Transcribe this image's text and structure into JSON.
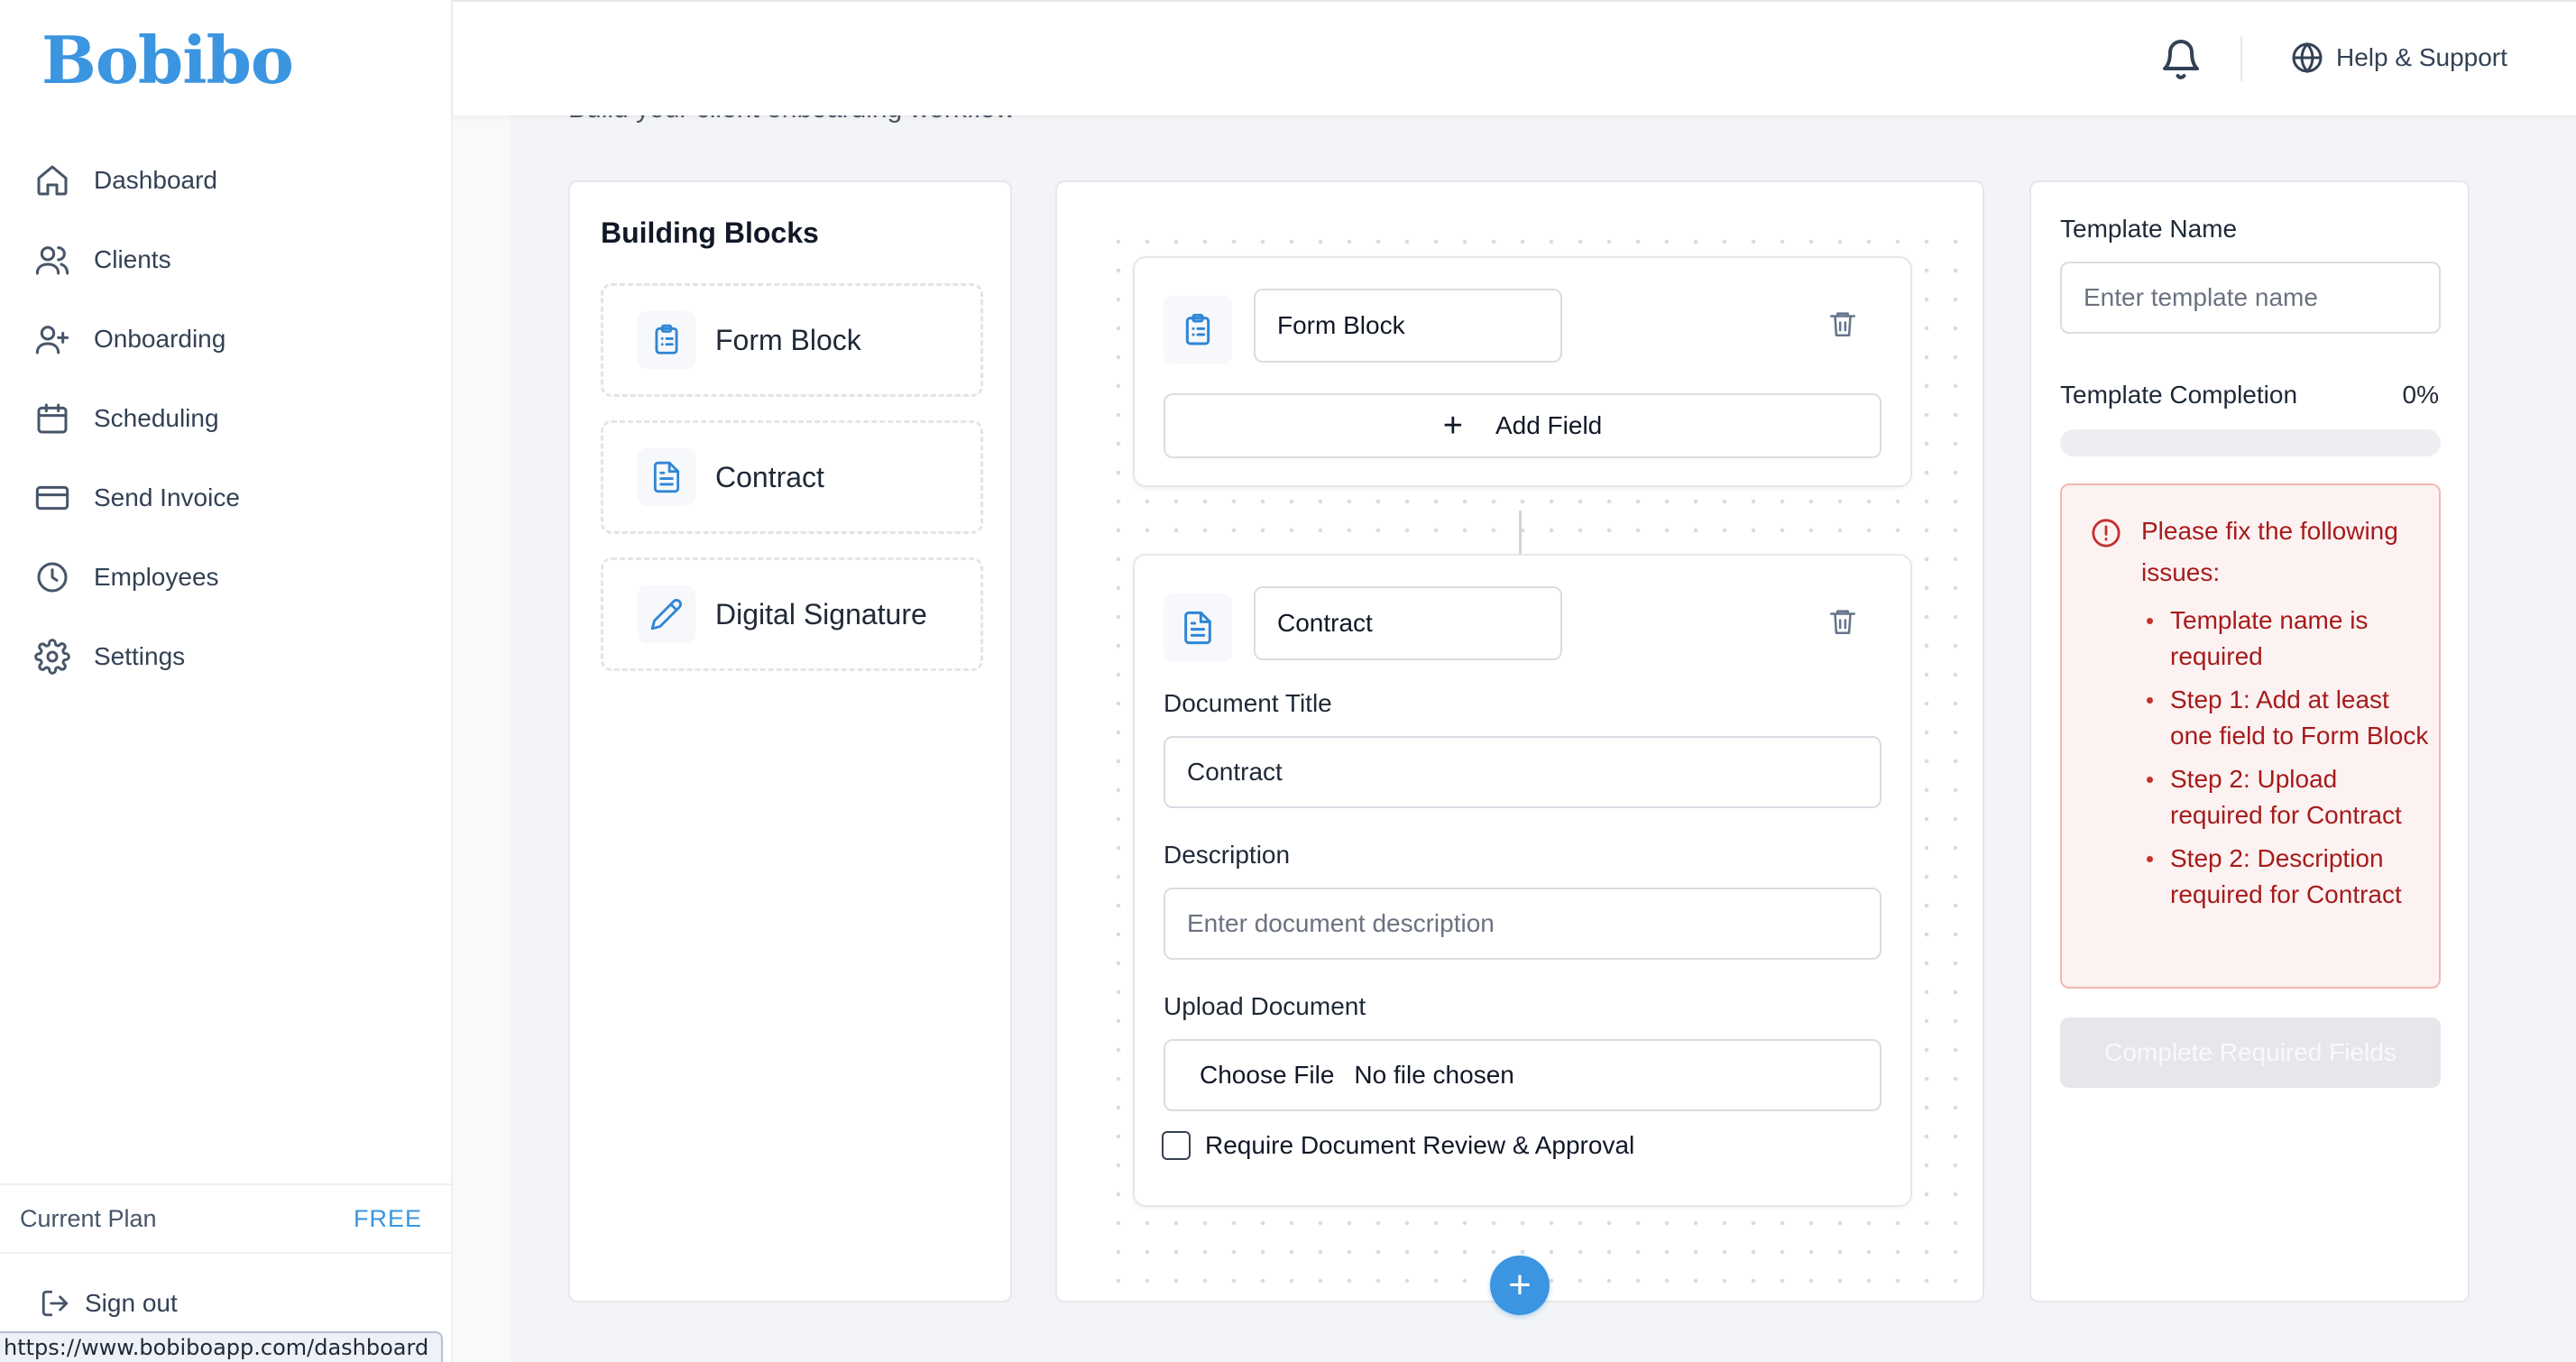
{
  "app": {
    "logo": "Bobibo"
  },
  "sidebar": {
    "items": [
      {
        "label": "Dashboard",
        "icon": "home-icon"
      },
      {
        "label": "Clients",
        "icon": "users-icon"
      },
      {
        "label": "Onboarding",
        "icon": "user-plus-icon"
      },
      {
        "label": "Scheduling",
        "icon": "calendar-icon"
      },
      {
        "label": "Send Invoice",
        "icon": "credit-card-icon"
      },
      {
        "label": "Employees",
        "icon": "clock-icon"
      },
      {
        "label": "Settings",
        "icon": "gear-icon"
      }
    ],
    "plan_label": "Current Plan",
    "plan_value": "FREE",
    "signout_label": "Sign out"
  },
  "status_bar": {
    "url": "https://www.bobiboapp.com/dashboard"
  },
  "header": {
    "help_label": "Help & Support"
  },
  "page": {
    "subtitle": "Build your client onboarding workflow"
  },
  "building_blocks": {
    "title": "Building Blocks",
    "items": [
      {
        "label": "Form Block",
        "icon": "clipboard-list-icon"
      },
      {
        "label": "Contract",
        "icon": "document-icon"
      },
      {
        "label": "Digital Signature",
        "icon": "pen-icon"
      }
    ]
  },
  "canvas": {
    "steps": [
      {
        "name_value": "Form Block",
        "add_field_label": "Add Field"
      },
      {
        "name_value": "Contract",
        "document_title_label": "Document Title",
        "document_title_value": "Contract",
        "description_label": "Description",
        "description_placeholder": "Enter document description",
        "upload_label": "Upload Document",
        "choose_file_label": "Choose File",
        "no_file_label": "No file chosen",
        "review_label": "Require Document Review & Approval",
        "review_checked": false
      }
    ],
    "add_step_label": "+"
  },
  "template": {
    "name_label": "Template Name",
    "name_placeholder": "Enter template name",
    "completion_label": "Template Completion",
    "completion_value": "0%",
    "completion_fraction": 0,
    "errors_title": "Please fix the following issues:",
    "errors": [
      "Template name is required",
      "Step 1: Add at least one field to Form Block",
      "Step 2: Upload required for Contract",
      "Step 2: Description required for Contract"
    ],
    "submit_label": "Complete Required Fields"
  },
  "colors": {
    "brand": "#3b95e0",
    "error": "#a61b1b",
    "error_bg": "#fdf2f2"
  }
}
